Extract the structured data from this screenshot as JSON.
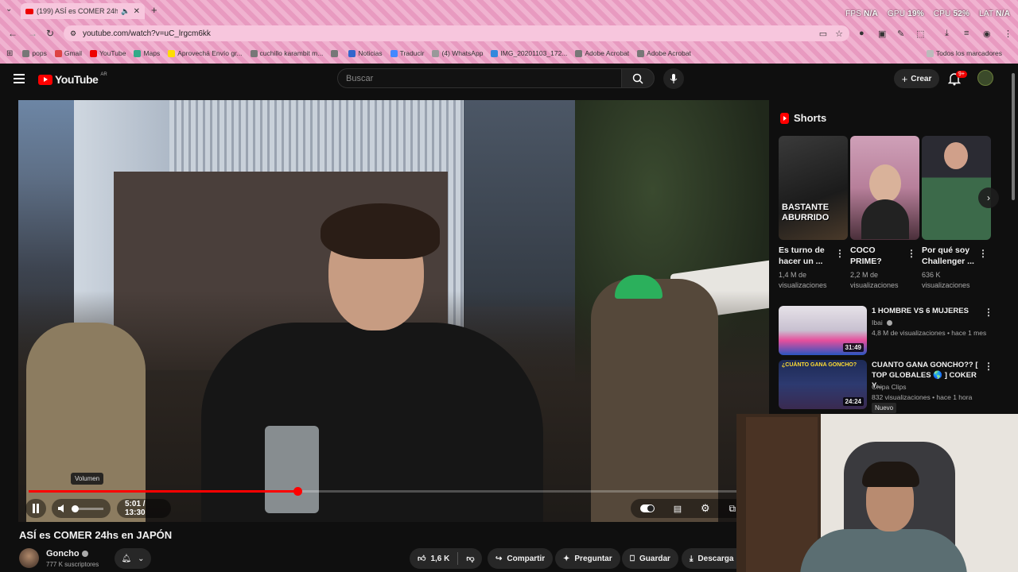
{
  "browser": {
    "tab_title": "(199) ASÍ es COMER 24hs e",
    "url": "youtube.com/watch?v=uC_lrgcm6kk",
    "stats": [
      {
        "label": "FPS",
        "value": "N/A"
      },
      {
        "label": "GPU",
        "value": "19%"
      },
      {
        "label": "CPU",
        "value": "52%"
      },
      {
        "label": "LAT",
        "value": "N/A"
      }
    ],
    "bookmarks": [
      "pops",
      "Gmail",
      "YouTube",
      "Maps",
      "Aprovechá Envío gr...",
      "cuchillo karambit m...",
      "",
      "Noticias",
      "Traducir",
      "(4) WhatsApp",
      "IMG_20201103_172...",
      "Adobe Acrobat",
      "Adobe Acrobat"
    ],
    "bookmarks_right": "Todos los marcadores",
    "accent": "#e89ac0"
  },
  "youtube": {
    "logo_text": "YouTube",
    "country": "AR",
    "search_placeholder": "Buscar",
    "create_label": "Crear",
    "notifications": "9+"
  },
  "player": {
    "tooltip": "Volumen",
    "time": "5:01 / 13:30",
    "progress": 0.37
  },
  "video": {
    "title": "ASÍ es COMER 24hs en JAPÓN",
    "channel": "Goncho",
    "subscribers": "777 K suscriptores",
    "likes": "1,6 K",
    "share": "Compartir",
    "ask": "Preguntar",
    "save": "Guardar",
    "download": "Descarga"
  },
  "shorts": {
    "heading": "Shorts",
    "items": [
      {
        "title": "Es turno de hacer un ...",
        "views": "1,4 M de visualizaciones",
        "overlay": "BASTANTE ABURRIDO"
      },
      {
        "title": "COCO PRIME?",
        "views": "2,2 M de visualizaciones",
        "overlay": ""
      },
      {
        "title": "Por qué soy Challenger ...",
        "views": "636 K visualizaciones",
        "overlay": ""
      }
    ]
  },
  "recommendations": [
    {
      "title": "1 HOMBRE VS 6 MUJERES",
      "channel": "Ibai",
      "meta": "4,8 M de visualizaciones • hace 1 mes",
      "duration": "31:49"
    },
    {
      "title": "CUANTO GANA GONCHO?? [ TOP GLOBALES 🌎 ] COKER Y...",
      "channel": "Chipa Clips",
      "meta": "832 visualizaciones • hace 1 hora",
      "duration": "24:24",
      "badge": "Nuevo",
      "thumb_text": "¿CUÁNTO GANA GONCHO?"
    }
  ]
}
